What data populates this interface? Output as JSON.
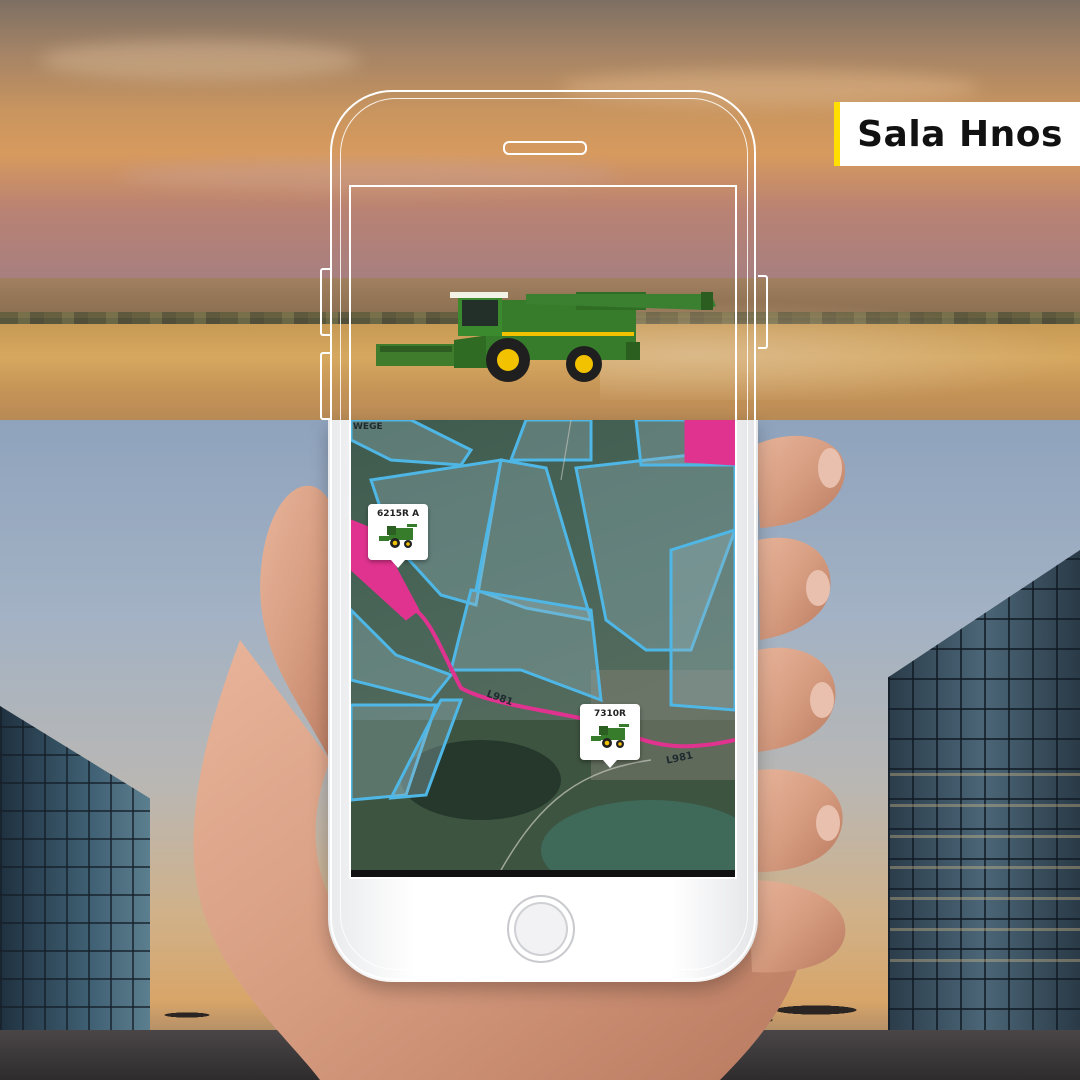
{
  "brand": {
    "name": "Sala Hnos",
    "accent": "#ffde00"
  },
  "map": {
    "field_outline_color": "#4fb7e6",
    "route_color": "#e0338f",
    "markers": [
      {
        "label": "6215R A",
        "icon": "combine-harvester-icon"
      },
      {
        "label": "7310R",
        "icon": "combine-harvester-icon"
      }
    ],
    "road_labels": [
      "L981",
      "L981",
      "WEGE"
    ]
  },
  "scene": {
    "top": "combine-harvester-in-wheat-field",
    "bottom": "hand-holding-phone-in-city-plaza"
  }
}
